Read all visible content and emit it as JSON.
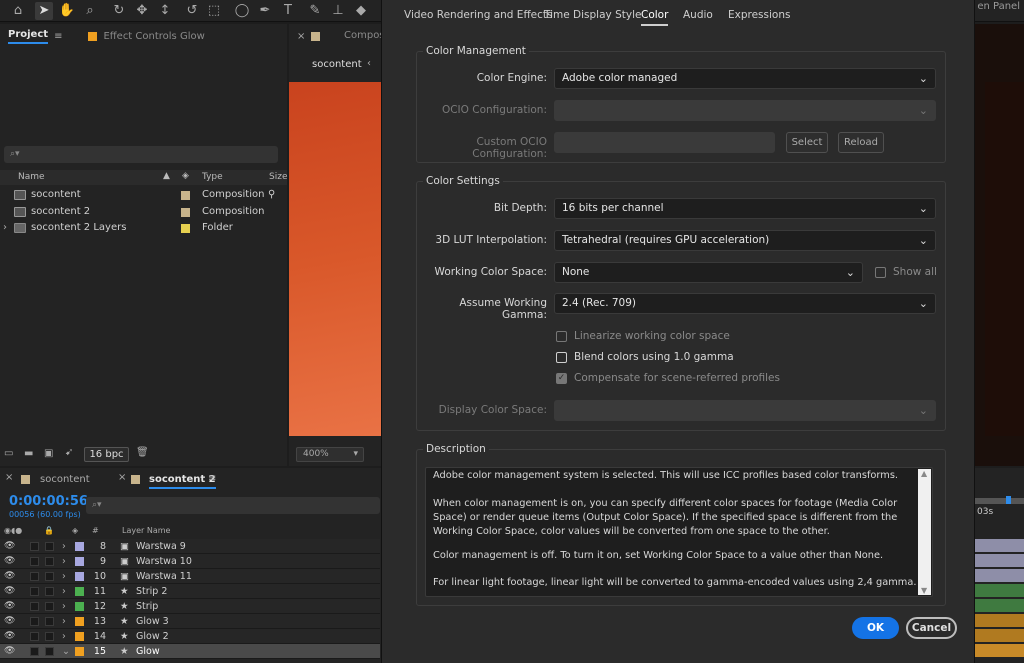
{
  "app": {
    "panel_label": "en Panel",
    "tools": [
      "home-icon",
      "selection-tool-icon",
      "hand-tool-icon",
      "zoom-tool-icon",
      "orbit-tool-icon",
      "pan-tool-icon",
      "dolly-tool-icon",
      "rotate-tool-icon",
      "pan-behind-icon",
      "ellipse-tool-icon",
      "pen-tool-icon",
      "type-tool-icon",
      "brush-tool-icon",
      "stamp-tool-icon",
      "eraser-tool-icon"
    ]
  },
  "project": {
    "tab": "Project",
    "effect_tab": "Effect Controls Glow",
    "columns": {
      "name": "Name",
      "type": "Type",
      "size": "Size"
    },
    "items": [
      {
        "name": "socontent",
        "type": "Composition",
        "color": "#c8b48c"
      },
      {
        "name": "socontent 2",
        "type": "Composition",
        "color": "#c8b48c"
      },
      {
        "name": "socontent 2 Layers",
        "type": "Folder",
        "color": "#e6d050"
      }
    ],
    "bpc": "16 bpc"
  },
  "comp": {
    "tab": "Compos",
    "name": "socontent",
    "zoom": "400%"
  },
  "timeline": {
    "tabs": [
      "socontent",
      "socontent 2"
    ],
    "timecode": "0:00:00:56",
    "fps": "00056 (60.00 fps)",
    "layer_name_header": "Layer Name",
    "num_header": "#",
    "ruler_label": "03s",
    "layers": [
      {
        "num": "8",
        "name": "Warstwa 9",
        "color": "#a8a8e0",
        "kind": "footage"
      },
      {
        "num": "9",
        "name": "Warstwa 10",
        "color": "#a8a8e0",
        "kind": "footage"
      },
      {
        "num": "10",
        "name": "Warstwa 11",
        "color": "#a8a8e0",
        "kind": "footage"
      },
      {
        "num": "11",
        "name": "Strip 2",
        "color": "#4cb050",
        "kind": "shape"
      },
      {
        "num": "12",
        "name": "Strip",
        "color": "#4cb050",
        "kind": "shape"
      },
      {
        "num": "13",
        "name": "Glow 3",
        "color": "#f0a020",
        "kind": "shape"
      },
      {
        "num": "14",
        "name": "Glow 2",
        "color": "#f0a020",
        "kind": "shape"
      },
      {
        "num": "15",
        "name": "Glow",
        "color": "#f0a020",
        "kind": "shape",
        "selected": true
      }
    ]
  },
  "dialog": {
    "tabs": [
      "Video Rendering and Effects",
      "Time Display Style",
      "Color",
      "Audio",
      "Expressions"
    ],
    "active_tab": "Color",
    "color_management": {
      "title": "Color Management",
      "engine_label": "Color Engine:",
      "engine_value": "Adobe color managed",
      "ocio_label": "OCIO Configuration:",
      "ocio_value": "",
      "custom_ocio_label": "Custom OCIO Configuration:",
      "custom_ocio_value": "",
      "select_btn": "Select",
      "reload_btn": "Reload"
    },
    "color_settings": {
      "title": "Color Settings",
      "bit_depth_label": "Bit Depth:",
      "bit_depth_value": "16 bits per channel",
      "lut_label": "3D LUT Interpolation:",
      "lut_value": "Tetrahedral (requires GPU acceleration)",
      "working_space_label": "Working Color Space:",
      "working_space_value": "None",
      "show_all_label": "Show all",
      "show_all_checked": false,
      "gamma_label": "Assume Working Gamma:",
      "gamma_value": "2.4 (Rec. 709)",
      "linearize_label": "Linearize working color space",
      "linearize_checked": false,
      "blend_label": "Blend colors using 1.0 gamma",
      "blend_checked": false,
      "compensate_label": "Compensate for scene-referred profiles",
      "compensate_checked": true,
      "display_space_label": "Display Color Space:",
      "display_space_value": ""
    },
    "description": {
      "title": "Description",
      "p1": "Adobe color management system is selected. This will use ICC profiles based color transforms.",
      "p2": "When color management is on, you can specify different color spaces for footage (Media Color Space) or render queue items (Output Color Space). If the specified space is different from the Working Color Space, color values will be converted from one space to the other.",
      "p3": "Color management is off. To turn it on, set Working Color Space to a value other than None.",
      "p4": "For linear light footage, linear light will be converted to gamma-encoded values using 2,4 gamma."
    },
    "ok": "OK",
    "cancel": "Cancel"
  }
}
